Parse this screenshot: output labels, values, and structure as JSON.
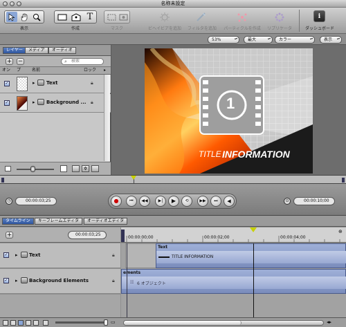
{
  "window": {
    "title": "名称未設定"
  },
  "toolbar": {
    "view_label": "表示",
    "create_label": "作成",
    "mask_label": "マスク",
    "behavior_label": "ビヘイビアを追加",
    "filter_label": "フィルタを追加",
    "particle_label": "パーティクルを作成",
    "replicator_label": "リプリケータ",
    "dashboard_label": "ダッシュボード"
  },
  "optbar": {
    "zoom": "53%",
    "quality": "最大",
    "color": "カラー",
    "view": "表示"
  },
  "layers_panel": {
    "tabs": [
      "レイヤー",
      "メディア",
      "オーディオ"
    ],
    "search_placeholder": "検索",
    "columns": {
      "on": "オン",
      "preview": "プ",
      "name": "名前",
      "lock": "ロック"
    },
    "rows": [
      {
        "name": "Text"
      },
      {
        "name": "Background ..."
      }
    ]
  },
  "canvas": {
    "title_thin": "TITLE",
    "title_bold": "INFORMATION",
    "number": "1"
  },
  "transport": {
    "current_time": "00:00:03;25",
    "duration": "00:00:10;00"
  },
  "timeline": {
    "tabs": [
      "タイムライン",
      "キーフレームエディタ",
      "オーディオエディタ"
    ],
    "current_time": "00:00:03;25",
    "ruler_labels": [
      "00:00:00;00",
      "00:00:02;00",
      "00:00:04;00"
    ],
    "rows": [
      {
        "name": "Text",
        "bar_header": "Text",
        "bar_label": "TITLE INFORMATION"
      },
      {
        "name": "Background Elements",
        "bar_header": "ements",
        "bar_label": "6 オブジェクト"
      }
    ]
  },
  "colors": {
    "accent": "#3a64b0",
    "clip": "#8a9cc8",
    "playhead": "#c8d200"
  }
}
